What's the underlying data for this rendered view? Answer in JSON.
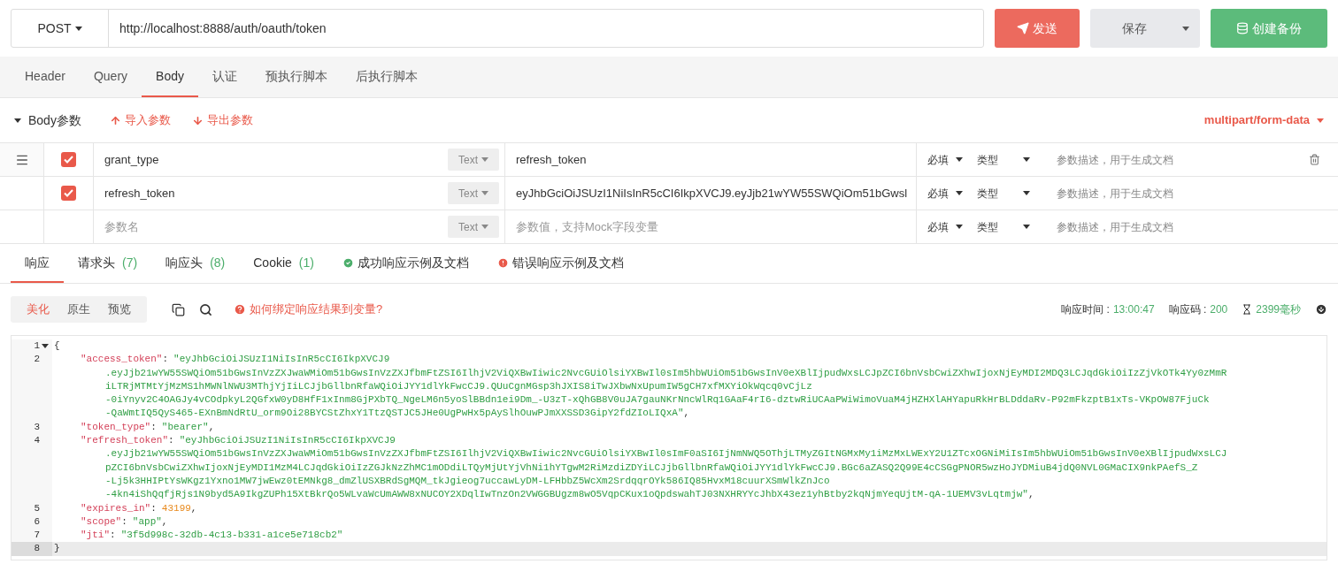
{
  "request": {
    "method": "POST",
    "url": "http://localhost:8888/auth/oauth/token",
    "send": "发送",
    "save": "保存",
    "backup": "创建备份"
  },
  "tabs": [
    {
      "label": "Header",
      "selected": false
    },
    {
      "label": "Query",
      "selected": false
    },
    {
      "label": "Body",
      "selected": true
    },
    {
      "label": "认证",
      "selected": false
    },
    {
      "label": "预执行脚本",
      "selected": false
    },
    {
      "label": "后执行脚本",
      "selected": false
    }
  ],
  "body": {
    "title": "Body参数",
    "expanded": true,
    "import": "导入参数",
    "export": "导出参数",
    "content_type": "multipart/form-data"
  },
  "params": [
    {
      "kind": "param",
      "active": true,
      "checked": true,
      "name": "grant_type",
      "type": "Text",
      "value": "refresh_token",
      "required": "必填",
      "value_type": "类型",
      "description_placeholder": "参数描述，用于生成文档"
    },
    {
      "kind": "param",
      "active": false,
      "checked": true,
      "name": "refresh_token",
      "type": "Text",
      "value": "eyJhbGciOiJSUzI1NiIsInR5cCI6IkpXVCJ9.eyJjb21wYW55SWQiOm51bGwsl",
      "required": "必填",
      "value_type": "类型",
      "description_placeholder": "参数描述，用于生成文档"
    },
    {
      "kind": "new",
      "active": false,
      "name_placeholder": "参数名",
      "type": "Text",
      "value_placeholder": "参数值，支持Mock字段变量",
      "required": "必填",
      "value_type": "类型",
      "description_placeholder": "参数描述，用于生成文档"
    }
  ],
  "response_tabs": [
    {
      "kind": "plain",
      "label": "响应",
      "selected": true
    },
    {
      "kind": "count",
      "label": "请求头",
      "count": "(7)",
      "selected": false
    },
    {
      "kind": "count",
      "label": "响应头",
      "count": "(8)",
      "selected": false
    },
    {
      "kind": "count",
      "label": "Cookie",
      "count": "(1)",
      "selected": false
    },
    {
      "kind": "success",
      "label": "成功响应示例及文档",
      "selected": false
    },
    {
      "kind": "error",
      "label": "错误响应示例及文档",
      "selected": false
    }
  ],
  "view_modes": [
    {
      "label": "美化",
      "selected": true
    },
    {
      "label": "原生",
      "selected": false
    },
    {
      "label": "预览",
      "selected": false
    }
  ],
  "help_link": "如何绑定响应结果到变量?",
  "stats": [
    {
      "label": "响应时间 :",
      "value": "13:00:47"
    },
    {
      "label": "响应码 :",
      "value": "200"
    }
  ],
  "duration": "2399毫秒",
  "code": [
    {
      "number": "1",
      "kind": "open",
      "text": "{",
      "foldable": true,
      "current": false
    },
    {
      "number": "2",
      "kind": "string",
      "key": "\"access_token\"",
      "colon": ":",
      "rows": [
        "\"eyJhbGciOiJSUzI1NiIsInR5cCI6IkpXVCJ9",
        ".eyJjb21wYW55SWQiOm51bGwsInVzZXJwaWMiOm51bGwsInVzZXJfbmFtZSI6IlhjV2ViQXBwIiwic2NvcGUiOlsiYXBwIl0sIm5hbWUiOm51bGwsInV0eXBlIjpudWxsLCJpZCI6bnVsbCwiZXhwIjoxNjEyMDI2MDQ3LCJqdGkiOiIzZjVkOTk4Yy0zMmR",
        "iLTRjMTMtYjMzMS1hMWNlNWU3MThjYjIiLCJjbGllbnRfaWQiOiJYY1dlYkFwcCJ9.QUuCgnMGsp3hJXIS8iTwJXbwNxUpumIW5gCH7xfMXYiOkWqcq0vCjLz",
        "-0iYnyv2C4OAGJy4vCOdpkyL2QGfxW0yD8HfF1xInm8GjPXbTQ_NgeLM6n5yoSlBBdn1ei9Dm_-U3zT-xQhGB8V0uJA7gauNKrNncWlRq1GAaF4rI6-dztwRiUCAaPWiWimoVuaM4jHZHXlAHYapuRkHrBLDddaRv-P92mFkzptB1xTs-VKpOW87FjuCk",
        "-QaWmtIQ5QyS465-EXnBmNdRtU_orm9Oi28BYCStZhxY1TtzQSTJC5JHe0UgPwHx5pAySlhOuwPJmXXSSD3GipY2fdZIoLIQxA\""
      ],
      "tail": ",",
      "current": false
    },
    {
      "number": "3",
      "kind": "string",
      "key": "\"token_type\"",
      "colon": ":",
      "rows": [
        "\"bearer\""
      ],
      "tail": ",",
      "current": false
    },
    {
      "number": "4",
      "kind": "string",
      "key": "\"refresh_token\"",
      "colon": ":",
      "rows": [
        "\"eyJhbGciOiJSUzI1NiIsInR5cCI6IkpXVCJ9",
        ".eyJjb21wYW55SWQiOm51bGwsInVzZXJwaWMiOm51bGwsInVzZXJfbmFtZSI6IlhjV2ViQXBwIiwic2NvcGUiOlsiYXBwIl0sImF0aSI6IjNmNWQ5OThjLTMyZGItNGMxMy1iMzMxLWExY2U1ZTcxOGNiMiIsIm5hbWUiOm51bGwsInV0eXBlIjpudWxsLCJ",
        "pZCI6bnVsbCwiZXhwIjoxNjEyMDI1MzM4LCJqdGkiOiIzZGJkNzZhMC1mODdiLTQyMjUtYjVhNi1hYTgwM2RiMzdiZDYiLCJjbGllbnRfaWQiOiJYY1dlYkFwcCJ9.BGc6aZASQ2Q99E4cCSGgPNOR5wzHoJYDMiuB4jdQ0NVL0GMaCIX9nkPAefS_Z",
        "-Lj5k3HHIPtYsWKgz1Yxno1MW7jwEwz0tEMNkg8_dmZlUSXBRdSgMQM_tkJgieog7uccawLyDM-LFHbbZ5WcXm2SrdqqrOYk586IQ85HvxM18cuurXSmWlkZnJco",
        "-4kn4iShQqfjRjs1N9byd5A9IkgZUPh15XtBkrQo5WLvaWcUmAWW8xNUCOY2XDqlIwTnzOn2VWGGBUgzm8wO5VqpCKux1oQpdswahTJ03NXHRYYcJhbX43ez1yhBtby2kqNjmYeqUjtM-qA-1UEMV3vLqtmjw\""
      ],
      "tail": ",",
      "current": false
    },
    {
      "number": "5",
      "kind": "number",
      "key": "\"expires_in\"",
      "colon": ":",
      "rows": [
        "43199"
      ],
      "tail": ",",
      "current": false
    },
    {
      "number": "6",
      "kind": "string",
      "key": "\"scope\"",
      "colon": ":",
      "rows": [
        "\"app\""
      ],
      "tail": ",",
      "current": false
    },
    {
      "number": "7",
      "kind": "string",
      "key": "\"jti\"",
      "colon": ":",
      "rows": [
        "\"3f5d998c-32db-4c13-b331-a1ce5e718cb2\""
      ],
      "current": false
    },
    {
      "number": "8",
      "kind": "close",
      "text": "}",
      "foldable": false,
      "current": true
    }
  ]
}
